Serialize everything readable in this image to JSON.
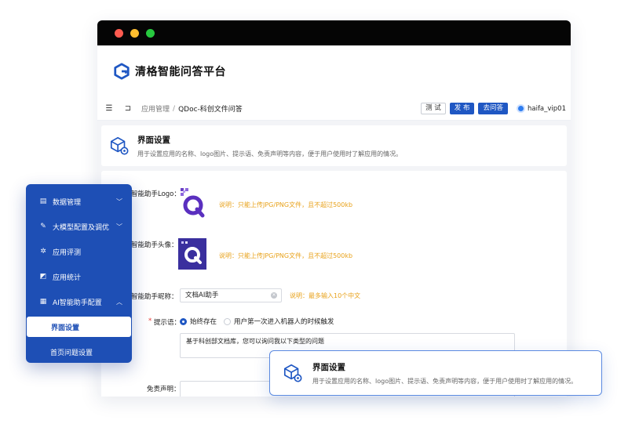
{
  "app": {
    "title": "清格智能问答平台"
  },
  "navbar": {
    "breadcrumb_parent": "应用管理",
    "breadcrumb_sep": "/",
    "breadcrumb_current": "QDoc-科创文件问答",
    "test_label": "测 试",
    "publish_label": "发 布",
    "ask_label": "去问答",
    "username": "haifa_vip01"
  },
  "header": {
    "title": "界面设置",
    "description": "用于设置应用的名称、logo图片、提示语、免责声明等内容，便于用户使用时了解应用的情况。"
  },
  "form": {
    "logo_label": "智能助手Logo：",
    "logo_hint": "说明：只能上传JPG/PNG文件，且不超过500kb",
    "avatar_label": "智能助手头像：",
    "avatar_hint": "说明：只能上传JPG/PNG文件，且不超过500kb",
    "nickname_label": "智能助手昵称：",
    "nickname_value": "文档AI助手",
    "nickname_hint": "说明：最多输入10个中文",
    "prompt_required": "*",
    "prompt_label": "提示语：",
    "prompt_option_1": "始终存在",
    "prompt_option_2": "用户第一次进入机器人的时候触发",
    "prompt_value": "基于科创部文档库，您可以询问我以下类型的问题",
    "disclaimer_label": "免责声明："
  },
  "sidebar": {
    "items": [
      {
        "label": "数据管理",
        "icon": "list-icon"
      },
      {
        "label": "大模型配置及调优",
        "icon": "wrench-icon"
      },
      {
        "label": "应用评测",
        "icon": "gear-icon"
      },
      {
        "label": "应用统计",
        "icon": "chart-icon"
      },
      {
        "label": "AI智能助手配置",
        "icon": "grid-icon"
      },
      {
        "label": "界面设置"
      },
      {
        "label": "首页问题设置"
      }
    ]
  },
  "tooltip": {
    "title": "界面设置",
    "description": "用于设置应用的名称、logo图片、提示语、免责声明等内容，便于用户使用时了解应用的情况。"
  },
  "colors": {
    "primary": "#1f57c3",
    "sidebar": "#1e4fb5",
    "hint": "#e8a21b"
  }
}
